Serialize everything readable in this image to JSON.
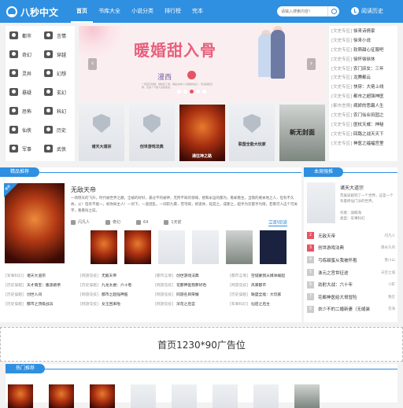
{
  "header": {
    "logo_text": "八秒中文",
    "nav": [
      "首页",
      "书库大全",
      "小说分类",
      "排行榜",
      "完本"
    ],
    "search_placeholder": "请输入搜索内容！",
    "history_label": "阅读历史"
  },
  "categories": [
    "都市",
    "言情",
    "奇幻",
    "穿越",
    "灵异",
    "幻想",
    "悬疑",
    "玄幻",
    "恐怖",
    "科幻",
    "仙侠",
    "历史",
    "军事",
    "武侠"
  ],
  "banner": {
    "title": "暖婚甜入骨",
    "author": "漫西",
    "subtitle": "一场宝贝替婚，她嫁给了他。他是北城人人畏惧的战少，传说其貌丑陋，还是个不能人道的变态。"
  },
  "banner_covers": [
    {
      "label": "诸天大道宗",
      "style": "gray"
    },
    {
      "label": "创世游戏法典",
      "style": "gray"
    },
    {
      "label": "通往神之路",
      "style": "fire"
    },
    {
      "label": "联盟全能大玩家",
      "style": "gray"
    },
    {
      "label": "新无封面",
      "style": "ink"
    }
  ],
  "side_list": [
    {
      "tag": "[文史专区]",
      "title": "徐来诗倩家"
    },
    {
      "tag": "[文史专区]",
      "title": "徐来小说"
    },
    {
      "tag": "[文史专区]",
      "title": "软萌甜心征服吧"
    },
    {
      "tag": "[文史专区]",
      "title": "徐怀徐徐休"
    },
    {
      "tag": "[文史专区]",
      "title": "农门庶女：三年"
    },
    {
      "tag": "[文史专区]",
      "title": "龙腾都云"
    },
    {
      "tag": "[文史专区]",
      "title": "快穿：大佬上线"
    },
    {
      "tag": "[文史专区]",
      "title": "都市之超强神医"
    },
    {
      "tag": "[都市言情]",
      "title": "病娇的恶霸人生"
    },
    {
      "tag": "[文史专区]",
      "title": "农门仙业田园之"
    },
    {
      "tag": "[文史专区]",
      "title": "医杖天威：神秘"
    },
    {
      "tag": "[文史专区]",
      "title": "回路之战天天下"
    },
    {
      "tag": "[文史专区]",
      "title": "神医之福福宫里"
    }
  ],
  "recommend": {
    "section_title": "精品推荐",
    "badge": "推荐",
    "book_title": "无敌天帝",
    "desc": "一场惊天的飞升，时代被世界之巅。全被的好好，豪过不的被神，无所不知的领域，授和永运的都为，看却看生，当我的要关地之人，但有不久依，火！但有不能一，如你知主人！一剑下。一道混乱，一剑斩九霄，苍穹碎，修道体，延度之，成那之，超手为云雷手为雨，若看可人这个可关字，看看叫之前。",
    "author": "闪凡人",
    "genre": "奇幻",
    "score": "64",
    "chapters": "1天前",
    "read_label": "立即阅读",
    "list": [
      [
        {
          "tag": "[军事科幻]",
          "title": "诸天大道宗"
        },
        {
          "tag": "[网游竞技]",
          "title": "无敌天帝"
        },
        {
          "tag": "[都市言情]",
          "title": "创世游戏法典"
        },
        {
          "tag": "[都市言情]",
          "title": "空城蒙我从媒体崛起"
        }
      ],
      [
        {
          "tag": "[历史穿越]",
          "title": "天才萌宝：腹黑娘亲"
        },
        {
          "tag": "[历史穿越]",
          "title": "九龙太君：六十卷"
        },
        {
          "tag": "[网游竞技]",
          "title": "花都神医我那好色"
        },
        {
          "tag": "[网游竞技]",
          "title": "风暴都市"
        }
      ],
      [
        {
          "tag": "[历史穿越]",
          "title": "创世人间"
        },
        {
          "tag": "[网游竞技]",
          "title": "都市之超强神医"
        },
        {
          "tag": "[网游竞技]",
          "title": "同游名目荣耀"
        },
        {
          "tag": "[历史穿越]",
          "title": "联盟全能：大玩家"
        }
      ],
      [
        {
          "tag": "[历史穿越]",
          "title": "都市之顶级战兵"
        },
        {
          "tag": "[网游竞技]",
          "title": "女王回来啦"
        },
        {
          "tag": "[网游竞技]",
          "title": "深花之后宫"
        },
        {
          "tag": "[军事科幻]",
          "title": "仙逆之后主"
        }
      ]
    ]
  },
  "rank": {
    "section_title": "本周强推",
    "top_title": "诸天大道宗",
    "top_desc": "苏辰穿越到了一个世界，这是一个有着修仙门派的世界。",
    "top_author": "作者：骑鲸海",
    "top_cat": "类型：军事科幻",
    "items": [
      {
        "title": "无敌天帝",
        "author": "闪凡人"
      },
      {
        "title": "创世游戏法典",
        "author": "愿永久的"
      },
      {
        "title": "弓练甜蜜从我被怀抱",
        "author": "鲁川山"
      },
      {
        "title": "诛元之宫世征途",
        "author": "天空之城"
      },
      {
        "title": "劲射大战：六十年",
        "author": "小轩"
      },
      {
        "title": "花都神医给大哥冒险",
        "author": "我在"
      },
      {
        "title": "衣少不的二婚新妻（无缝装",
        "author": "花海"
      }
    ]
  },
  "ad_text": "首页1230*90广告位",
  "hot": {
    "section_title": "热门推荐"
  }
}
